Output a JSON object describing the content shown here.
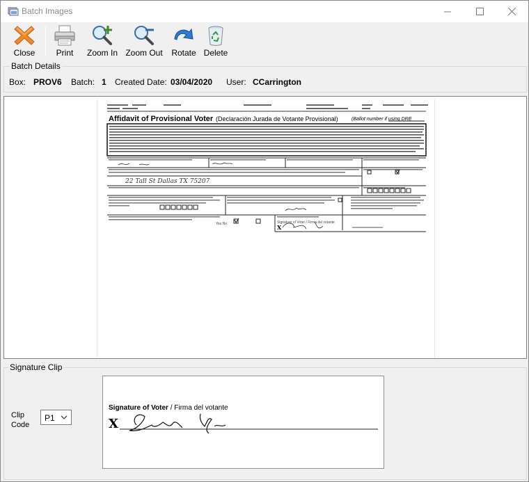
{
  "window": {
    "title": "Batch Images"
  },
  "toolbar": {
    "close_label": "Close",
    "print_label": "Print",
    "zoom_in_label": "Zoom In",
    "zoom_out_label": "Zoom Out",
    "rotate_label": "Rotate",
    "delete_label": "Delete"
  },
  "batch_details": {
    "legend": "Batch Details",
    "box_label": "Box:",
    "box_value": "PROV6",
    "batch_label": "Batch:",
    "batch_value": "1",
    "created_label": "Created Date:",
    "created_value": "03/04/2020",
    "user_label": "User:",
    "user_value": "CCarrington"
  },
  "document": {
    "heading": "Affidavit of Provisional Voter",
    "heading_spanish": "(Declaración Jurada de Votante Provisional)",
    "ballot_note": "(Ballot number if using DRE",
    "handwritten_address": "22 Tall St Dallas TX 75207",
    "signature_label": "Signature of Voter / Firma del votante",
    "check_note": "Yes No"
  },
  "signature_clip": {
    "legend": "Signature Clip",
    "caption_bold": "Signature of Voter",
    "caption_rest": " / Firma del votante",
    "x_mark": "X"
  },
  "clip_code": {
    "label_line1": "Clip",
    "label_line2": "Code",
    "selected": "P1"
  },
  "colors": {
    "close_icon": "#e8791b",
    "rotate_icon": "#1e6fc8",
    "zoom_icon": "#2f7ac2"
  }
}
